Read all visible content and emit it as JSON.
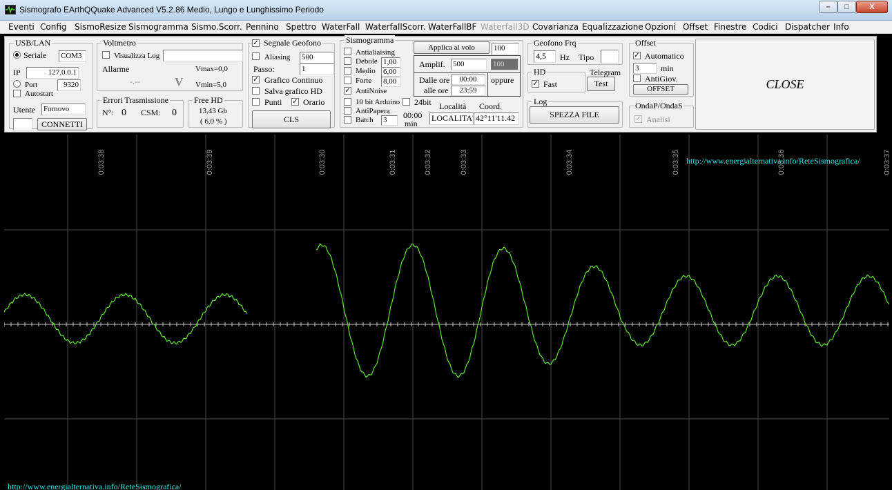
{
  "window": {
    "title": "Sismografo  EArthQQuake Advanced V5.2.86  Medio, Lungo e Lunghissimo Periodo",
    "min_symbol": "–",
    "max_symbol": "□",
    "close_symbol": "X"
  },
  "menu": [
    "Eventi",
    "Config",
    "SismoResize",
    "Sismogramma",
    "Sismo.Scorr.",
    "Pennino",
    "Spettro",
    "WaterFall",
    "WaterfallScorr.",
    "WaterFallBF",
    "Waterfall3D",
    "Covarianza",
    "Equalizzazione",
    "Opzioni",
    "Offset",
    "Finestre",
    "Codici",
    "Dispatcher",
    "Info"
  ],
  "menu_disabled": "Waterfall3D",
  "usb": {
    "group": "USB/LAN",
    "seriale_label": "Seriale",
    "com": "COM3",
    "ip_label": "IP",
    "ip": "127.0.0.1",
    "port_label": "Port",
    "port": "9320",
    "autostart_label": "Autostart",
    "utente_label": "Utente",
    "utente": "Fornovo",
    "connect_label": "CONNETTI"
  },
  "voltmetro": {
    "group": "Voltmetro",
    "visualizza_label": "Visualizza Log",
    "allarme_label": "Allarme",
    "vmax": "Vmax=0,0",
    "vmin": "Vmin=5,0",
    "reading": "-.--",
    "unit": "V"
  },
  "errori": {
    "group": "Errori Trasmissione",
    "n_label": "N°:",
    "n_value": "0",
    "csm_label": "CSM:",
    "csm_value": "0"
  },
  "freehd": {
    "group": "Free HD",
    "size": "13,43 Gb",
    "percent": "( 6,0 % )"
  },
  "segnale": {
    "group": "Segnale Geofono",
    "aliasing_label": "Aliasing",
    "aliasing_value": "500",
    "passo_label": "Passo:",
    "passo_value": "1",
    "grafico_label": "Grafico Continuo",
    "salva_label": "Salva grafico HD",
    "punti_label": "Punti",
    "orario_label": "Orario",
    "cls_label": "CLS"
  },
  "sismogramma": {
    "group": "Sismogramma",
    "antialiasing_label": "Antialiaising",
    "debole_label": "Debole",
    "debole_value": "1,00",
    "medio_label": "Medio",
    "medio_value": "6,00",
    "forte_label": "Forte",
    "forte_value": "8,00",
    "antinoise_label": "AntiNoise",
    "arduino_label": "10 bit Arduino",
    "bit24_label": "24bit",
    "antipapera_label": "AntiPapera",
    "batch_label": "Batch",
    "batch_value": "3",
    "batch_time": "00:00",
    "batch_unit": "min",
    "applica_label": "Applica al volo",
    "applica_value": "100",
    "amplif_label": "Amplif.",
    "amplif_value": "500",
    "amplif_dark": "100",
    "dalle_label": "Dalle ore",
    "dalle_value": "00:00",
    "alle_label": "alle ore",
    "alle_value": "23:59",
    "oppure_label": "oppure",
    "localita_label": "Località",
    "coord_label": "Coord.",
    "localita_value": "LOCALITA'",
    "coord_value": "42°11'11.42"
  },
  "geofono": {
    "group": "Geofono Frq",
    "freq": "4,5",
    "hz_label": "Hz",
    "tipo_label": "Tipo"
  },
  "hd": {
    "group": "HD",
    "fast_label": "Fast",
    "telegram_label": "Telegram",
    "test_label": "Test"
  },
  "log": {
    "group": "Log",
    "spezza_label": "SPEZZA FILE"
  },
  "offset": {
    "group": "Offset",
    "automatico_label": "Automatico",
    "min_value": "3",
    "min_label": "min",
    "antigiov_label": "AntiGiov.",
    "offset_button": "OFFSET"
  },
  "onda": {
    "group": "OndaP/OndaS",
    "analisi_label": "Analisi"
  },
  "close_label": "CLOSE",
  "seismogram": {
    "url_top": "http://www.energialternativa.info/ReteSismografica/",
    "url_bottom": "http://www.energialternativa.info/ReteSismografica/",
    "time_labels": [
      "0:03:38",
      "0:03:39",
      "0:03:30",
      "0:03:31",
      "0:03:32",
      "0:03:33",
      "0:03:34",
      "0:03:35",
      "0:03:36",
      "0:03:37"
    ],
    "colors": {
      "trace": "#5ee82a",
      "grid": "#4a4a4a",
      "axis": "#c8c8c8",
      "url": "#2ce8e8"
    }
  }
}
